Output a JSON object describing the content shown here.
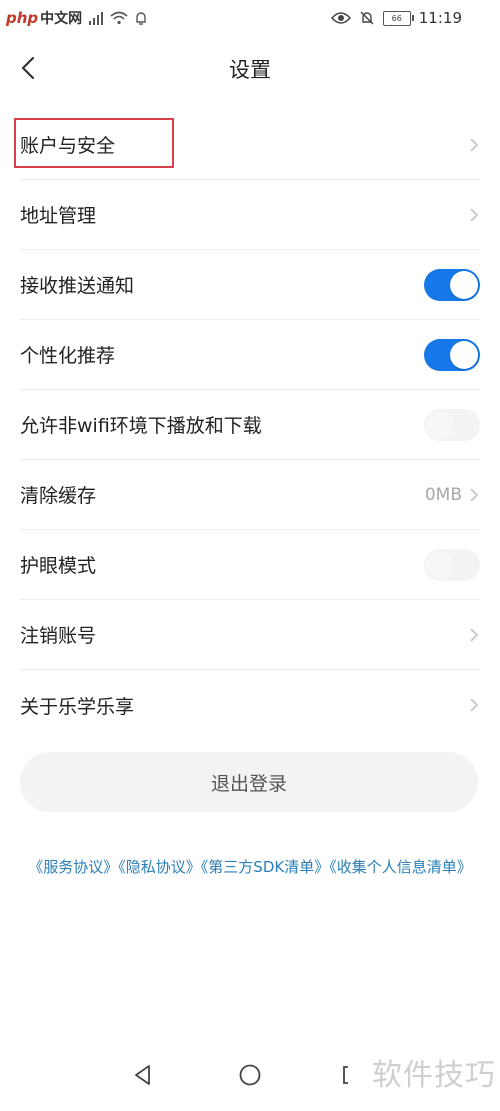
{
  "status_bar": {
    "watermark_php": "php",
    "watermark_cn": "中文网",
    "battery": "66",
    "time": "11:19"
  },
  "header": {
    "title": "设置"
  },
  "settings": {
    "account_security": {
      "label": "账户与安全"
    },
    "address": {
      "label": "地址管理"
    },
    "push": {
      "label": "接收推送通知",
      "enabled": true
    },
    "personalized": {
      "label": "个性化推荐",
      "enabled": true
    },
    "non_wifi": {
      "label": "允许非wifi环境下播放和下载",
      "enabled": false
    },
    "cache": {
      "label": "清除缓存",
      "value": "0MB"
    },
    "eye_mode": {
      "label": "护眼模式",
      "enabled": false
    },
    "deregister": {
      "label": "注销账号"
    },
    "about": {
      "label": "关于乐学乐享"
    }
  },
  "logout": {
    "label": "退出登录"
  },
  "agreements": {
    "service": "《服务协议》",
    "privacy": "《隐私协议》",
    "sdk": "《第三方SDK清单》",
    "personal_info": "《收集个人信息清单》"
  },
  "overlay": {
    "watermark": "软件技巧"
  },
  "colors": {
    "toggle_on": "#1677e8",
    "link": "#2c7fb8",
    "highlight": "#d9404b"
  }
}
